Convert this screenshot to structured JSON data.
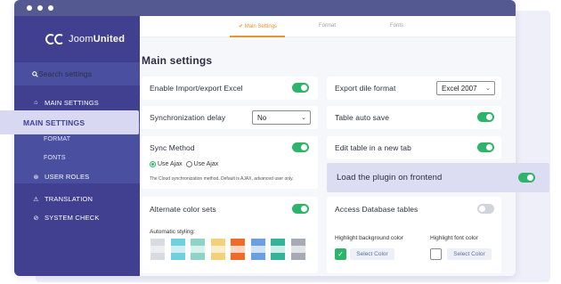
{
  "brand": {
    "name_prefix": "Joom",
    "name_suffix": "United"
  },
  "search": {
    "placeholder": "Search settings"
  },
  "sidebar": {
    "items": [
      {
        "label": "MAIN SETTINGS",
        "icon": "home-icon"
      },
      {
        "label": "USER ROLES",
        "icon": "user-roles-icon"
      },
      {
        "label": "TRANSLATION",
        "icon": "translation-icon"
      },
      {
        "label": "SYSTEM CHECK",
        "icon": "check-circle-icon"
      }
    ],
    "subitems": [
      "FORMAT",
      "FONTS"
    ],
    "floating_active": "MAIN SETTINGS"
  },
  "tabs": [
    {
      "label": "✔ Main Settings",
      "active": true
    },
    {
      "label": "Format",
      "active": false
    },
    {
      "label": "Fonts",
      "active": false
    }
  ],
  "main": {
    "title": "Main settings",
    "enable_import": {
      "label": "Enable Import/export Excel",
      "on": true
    },
    "export_format": {
      "label": "Export dile format",
      "value": "Excel 2007"
    },
    "sync_delay": {
      "label": "Synchronization delay",
      "value": "No"
    },
    "auto_save": {
      "label": "Table auto save",
      "on": true
    },
    "sync_method": {
      "label": "Sync Method",
      "on": true,
      "option_ajax": "Use Ajax",
      "option_ajax2": "Use Ajax",
      "note": "The Cloud synchronization method. Default is AJAX, advanced user only."
    },
    "edit_new_tab": {
      "label": "Edit table in a new tab",
      "on": true
    },
    "load_frontend": {
      "label": "Load the plugin on frontend",
      "on": true
    },
    "alt_colors": {
      "label": "Alternate color sets",
      "on": true,
      "auto_label": "Automatic styling:"
    },
    "access_db": {
      "label": "Access Database tables",
      "on": false
    },
    "highlight_bg": {
      "label": "Highlight background color",
      "button": "Select Color"
    },
    "highlight_font": {
      "label": "Highlight font color",
      "button": "Select Color"
    }
  },
  "colors": {
    "sidebar": "#413f8f",
    "titlebar": "#545991",
    "toggle_on": "#2eb46a",
    "accent": "#f0902a",
    "swatches": [
      [
        "#d9dbe3",
        "#eceef2",
        "#d9dbe3"
      ],
      [
        "#6fd1dc",
        "#cdeff3",
        "#6fd1dc"
      ],
      [
        "#8fd3c6",
        "#d7f1ec",
        "#8fd3c6"
      ],
      [
        "#f3d07a",
        "#fbeecb",
        "#f3d07a"
      ],
      [
        "#f06a2a",
        "#fbd5c0",
        "#f06a2a"
      ],
      [
        "#6aa0e0",
        "#d2e2f7",
        "#6aa0e0"
      ],
      [
        "#34b39a",
        "#cbeee6",
        "#34b39a"
      ],
      [
        "#a7a9b3",
        "#e3e4e8",
        "#a7a9b3"
      ]
    ]
  }
}
